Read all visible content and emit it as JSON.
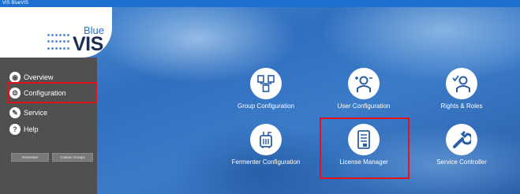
{
  "window": {
    "title": "VIS BlueVIS"
  },
  "logo": {
    "top_text": "Blue",
    "main_text": "VIS"
  },
  "sidebar": {
    "items": [
      {
        "label": "Overview",
        "icon": "overview-icon"
      },
      {
        "label": "Configuration",
        "icon": "configuration-icon",
        "selected": true
      },
      {
        "label": "Service",
        "icon": "service-icon"
      },
      {
        "label": "Help",
        "icon": "help-icon"
      }
    ],
    "buttons": [
      {
        "label": "Fermenter"
      },
      {
        "label": "Custom Groups"
      }
    ]
  },
  "tiles": [
    {
      "label": "Group Configuration",
      "icon": "group-configuration-icon"
    },
    {
      "label": "User Configuration",
      "icon": "user-configuration-icon"
    },
    {
      "label": "Rights & Roles",
      "icon": "rights-roles-icon"
    },
    {
      "label": "Fermenter Configuration",
      "icon": "fermenter-configuration-icon"
    },
    {
      "label": "License Manager",
      "icon": "license-manager-icon",
      "highlighted": true
    },
    {
      "label": "Service Controller",
      "icon": "service-controller-icon"
    }
  ],
  "colors": {
    "accent": "#2a6fc8",
    "highlight": "#e3131b",
    "sidebar": "#505050"
  }
}
